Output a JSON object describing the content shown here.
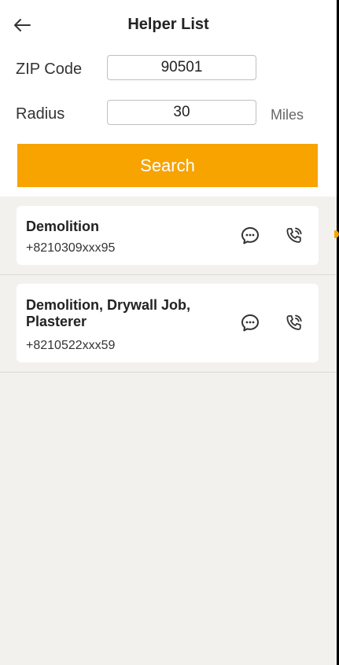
{
  "header": {
    "title": "Helper List",
    "back_icon": "arrow-left-icon"
  },
  "form": {
    "zip_label": "ZIP Code",
    "zip_value": "90501",
    "radius_label": "Radius",
    "radius_value": "30",
    "radius_unit": "Miles",
    "search_label": "Search"
  },
  "helpers": [
    {
      "title": "Demolition",
      "phone": "+8210309xxx95"
    },
    {
      "title": "Demolition, Drywall Job, Plasterer",
      "phone": "+8210522xxx59"
    }
  ],
  "colors": {
    "accent": "#f7a300",
    "background": "#f2f1ee",
    "card": "#ffffff"
  }
}
